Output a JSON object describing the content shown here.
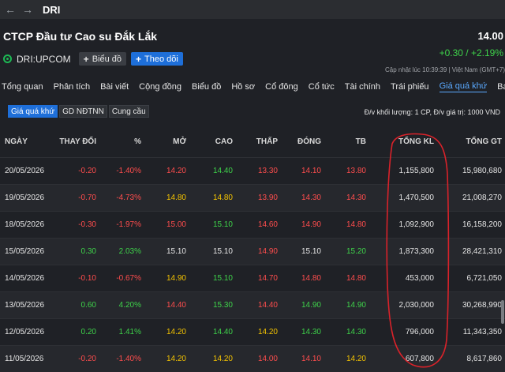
{
  "window": {
    "title": "DRI",
    "back_icon": "arrow-left-icon",
    "forward_icon": "arrow-right-icon"
  },
  "stock": {
    "company": "CTCP Đầu tư Cao su Đắk Lắk",
    "ticker": "DRI:UPCOM",
    "price": "14.00",
    "change": "+0.30 / +2.19%",
    "updated": "Cập nhật lúc  10:39:39 | Việt Nam (GMT+7)",
    "chart_button": "Biểu đồ",
    "follow_button": "Theo dõi"
  },
  "tabs": [
    "Tổng quan",
    "Phân tích",
    "Bài viết",
    "Cộng đồng",
    "Biểu đồ",
    "Hồ sơ",
    "Cổ đông",
    "Cổ tức",
    "Tài chính",
    "Trái phiếu",
    "Giá quá khứ",
    "Báo cáo"
  ],
  "active_tab": "Giá quá khứ",
  "subtabs": [
    "Giá quá khứ",
    "GD NĐTNN",
    "Cung cầu"
  ],
  "unit_note": "Đ/v khối lượng: 1 CP, Đ/v giá trị: 1000 VND",
  "table": {
    "headers": [
      "NGÀY",
      "THAY ĐỔI",
      "%",
      "MỞ",
      "CAO",
      "THẤP",
      "ĐÓNG",
      "TB",
      "TỔNG KL",
      "TỔNG GT"
    ],
    "rows": [
      [
        "20/05/2026",
        "-0.20",
        "-1.40%",
        "14.20",
        "14.40",
        "13.30",
        "14.10",
        "13.80",
        "1,155,800",
        "15,980,680"
      ],
      [
        "19/05/2026",
        "-0.70",
        "-4.73%",
        "14.80",
        "14.80",
        "13.90",
        "14.30",
        "14.30",
        "1,470,500",
        "21,008,270"
      ],
      [
        "18/05/2026",
        "-0.30",
        "-1.97%",
        "15.00",
        "15.10",
        "14.60",
        "14.90",
        "14.80",
        "1,092,900",
        "16,158,200"
      ],
      [
        "15/05/2026",
        "0.30",
        "2.03%",
        "15.10",
        "15.10",
        "14.90",
        "15.10",
        "15.20",
        "1,873,300",
        "28,421,310"
      ],
      [
        "14/05/2026",
        "-0.10",
        "-0.67%",
        "14.90",
        "15.10",
        "14.70",
        "14.80",
        "14.80",
        "453,000",
        "6,721,050"
      ],
      [
        "13/05/2026",
        "0.60",
        "4.20%",
        "14.40",
        "15.30",
        "14.40",
        "14.90",
        "14.90",
        "2,030,000",
        "30,268,990"
      ],
      [
        "12/05/2026",
        "0.20",
        "1.41%",
        "14.20",
        "14.40",
        "14.20",
        "14.30",
        "14.30",
        "796,000",
        "11,343,350"
      ],
      [
        "11/05/2026",
        "-0.20",
        "-1.40%",
        "14.20",
        "14.20",
        "14.00",
        "14.10",
        "14.20",
        "607,800",
        "8,617,860"
      ]
    ],
    "colors": [
      [
        "white",
        "red",
        "red",
        "red",
        "green",
        "red",
        "red",
        "red",
        "white",
        "white"
      ],
      [
        "white",
        "red",
        "red",
        "yellow",
        "yellow",
        "red",
        "red",
        "red",
        "white",
        "white"
      ],
      [
        "white",
        "red",
        "red",
        "red",
        "green",
        "red",
        "red",
        "red",
        "white",
        "white"
      ],
      [
        "white",
        "green",
        "green",
        "white",
        "white",
        "red",
        "white",
        "green",
        "white",
        "white"
      ],
      [
        "white",
        "red",
        "red",
        "yellow",
        "green",
        "red",
        "red",
        "red",
        "white",
        "white"
      ],
      [
        "white",
        "green",
        "green",
        "red",
        "green",
        "red",
        "green",
        "green",
        "white",
        "white"
      ],
      [
        "white",
        "green",
        "green",
        "yellow",
        "green",
        "yellow",
        "green",
        "green",
        "white",
        "white"
      ],
      [
        "white",
        "red",
        "red",
        "yellow",
        "yellow",
        "red",
        "red",
        "yellow",
        "white",
        "white"
      ]
    ]
  },
  "palette": {
    "red": "#ff4d4d",
    "green": "#3ed24a",
    "yellow": "#f5c400",
    "white": "#e6e6e6",
    "accent": "#1e6fd9",
    "annotation": "#d9222a"
  }
}
